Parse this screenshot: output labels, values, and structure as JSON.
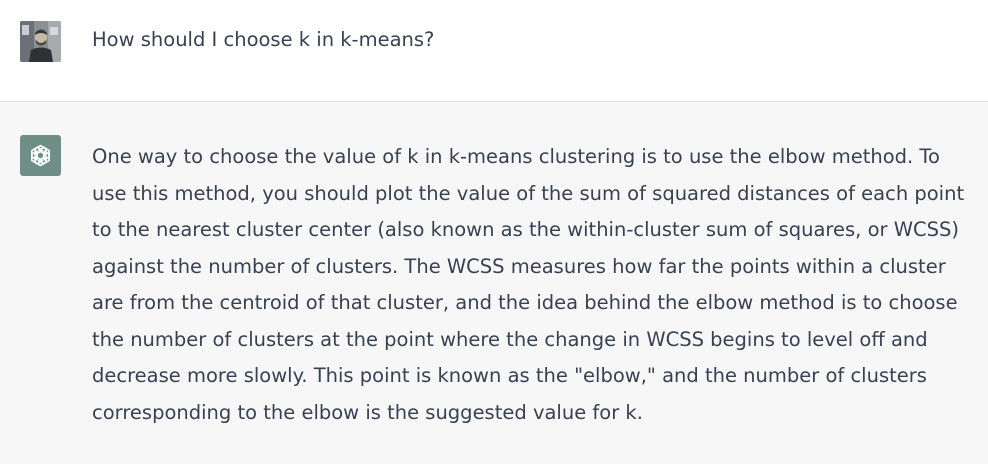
{
  "conversation": {
    "user_message": {
      "avatar_icon": "user-photo-avatar",
      "text": "How should I choose k in k-means?"
    },
    "assistant_message": {
      "avatar_icon": "openai-logo-icon",
      "avatar_color": "#6f8f86",
      "text": "One way to choose the value of k in k-means clustering is to use the elbow method. To use this method, you should plot the value of the sum of squared distances of each point to the nearest cluster center (also known as the within-cluster sum of squares, or WCSS) against the number of clusters. The WCSS measures how far the points within a cluster are from the centroid of that cluster, and the idea behind the elbow method is to choose the number of clusters at the point where the change in WCSS begins to level off and decrease more slowly. This point is known as the \"elbow,\" and the number of clusters corresponding to the elbow is the suggested value for k."
    }
  }
}
